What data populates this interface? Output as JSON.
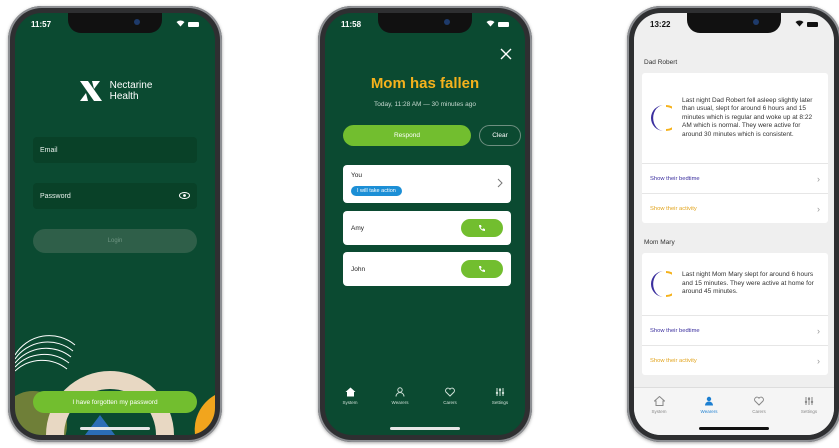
{
  "phone1": {
    "time": "11:57",
    "logo_line1": "Nectarine",
    "logo_line2": "Health",
    "email_label": "Email",
    "password_label": "Password",
    "login_label": "Login",
    "forgot_label": "I have forgotten my password"
  },
  "phone2": {
    "time": "11:58",
    "title": "Mom has fallen",
    "subtitle": "Today, 11:28 AM — 30 minutes ago",
    "respond_label": "Respond",
    "clear_label": "Clear",
    "you_label": "You",
    "you_tag": "I will take action",
    "contacts": [
      {
        "name": "Amy"
      },
      {
        "name": "John"
      }
    ],
    "tabs": [
      {
        "label": "System",
        "icon": "home-icon"
      },
      {
        "label": "Wearers",
        "icon": "person-icon"
      },
      {
        "label": "Carers",
        "icon": "heart-icon"
      },
      {
        "label": "Settings",
        "icon": "sliders-icon"
      }
    ]
  },
  "phone3": {
    "time": "13:22",
    "sections": [
      {
        "name": "Dad Robert",
        "summary": "Last night Dad Robert fell asleep slightly later than usual, slept for around 6 hours and 15 minutes which is regular and woke up at 8:22 AM which is normal. They were active for around 30 minutes which is consistent.",
        "bedtime_link": "Show their bedtime",
        "activity_link": "Show their activity"
      },
      {
        "name": "Mom Mary",
        "summary": "Last night Mom Mary slept for around 6 hours and 15 minutes. They were active at home for around 45 minutes.",
        "bedtime_link": "Show their bedtime",
        "activity_link": "Show their activity"
      }
    ],
    "tabs": [
      {
        "label": "System",
        "icon": "home-icon"
      },
      {
        "label": "Wearers",
        "icon": "person-icon"
      },
      {
        "label": "Carers",
        "icon": "heart-icon"
      },
      {
        "label": "Settings",
        "icon": "sliders-icon"
      }
    ],
    "active_tab": "Wearers"
  },
  "colors": {
    "brand_green": "#0b4a31",
    "accent_green": "#72be2f",
    "alert_orange": "#f5b21c",
    "tag_blue": "#1c8fd6",
    "bedtime_purple": "#3b2f9e",
    "activity_orange": "#e2a41d"
  }
}
